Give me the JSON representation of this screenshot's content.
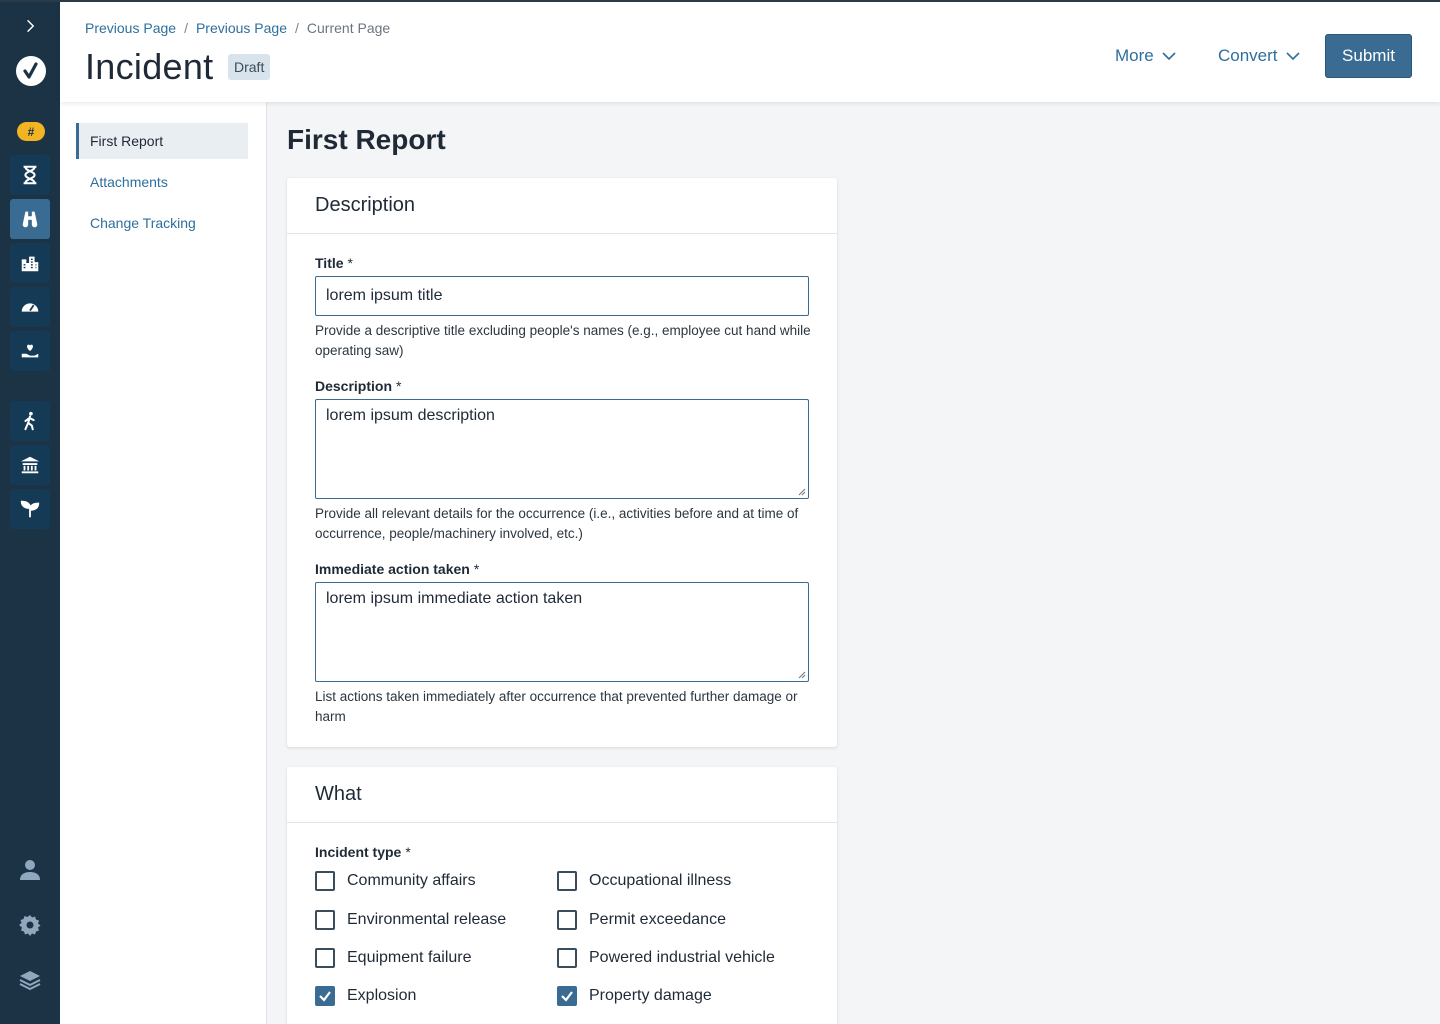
{
  "rail": {
    "badge": "#",
    "items": [
      {
        "icon": "hourglass-icon"
      },
      {
        "icon": "binoculars-icon"
      },
      {
        "icon": "buildings-icon"
      },
      {
        "icon": "speedometer-icon"
      },
      {
        "icon": "hand-heart-icon"
      },
      {
        "icon": "walking-person-icon"
      },
      {
        "icon": "institution-icon"
      },
      {
        "icon": "sprout-icon"
      }
    ],
    "bottom": [
      {
        "icon": "user-icon"
      },
      {
        "icon": "gear-icon"
      },
      {
        "icon": "layers-icon"
      }
    ]
  },
  "header": {
    "breadcrumb": [
      "Previous Page",
      "Previous Page",
      "Current Page"
    ],
    "title": "Incident",
    "status": "Draft",
    "more_label": "More",
    "convert_label": "Convert",
    "submit_label": "Submit"
  },
  "secnav": {
    "items": [
      "First Report",
      "Attachments",
      "Change Tracking"
    ],
    "active": "First Report"
  },
  "main": {
    "title": "First Report",
    "description_card": {
      "heading": "Description",
      "title_label": "Title",
      "title_value": "lorem ipsum title",
      "title_help": "Provide a descriptive title excluding people's names (e.g., employee cut hand while operating saw)",
      "description_label": "Description",
      "description_value": "lorem ipsum description",
      "description_help": "Provide all relevant details for the occurrence (i.e., activities before and at time of occurrence, people/machinery involved, etc.)",
      "action_label": "Immediate action taken",
      "action_value": "lorem ipsum immediate action taken",
      "action_help": "List actions taken immediately after occurrence that prevented further damage or harm",
      "required_mark": "*"
    },
    "what_card": {
      "heading": "What",
      "incident_type_label": "Incident type",
      "required_mark": "*",
      "options": [
        {
          "label": "Community affairs",
          "checked": false
        },
        {
          "label": "Occupational illness",
          "checked": false
        },
        {
          "label": "Environmental release",
          "checked": false
        },
        {
          "label": "Permit exceedance",
          "checked": false
        },
        {
          "label": "Equipment failure",
          "checked": false
        },
        {
          "label": "Powered industrial vehicle",
          "checked": false
        },
        {
          "label": "Explosion",
          "checked": true
        },
        {
          "label": "Property damage",
          "checked": true
        }
      ]
    }
  },
  "colors": {
    "rail": "#1b3345",
    "accent": "#3a6c93",
    "link": "#2e6f9e",
    "badge": "#f2b423"
  }
}
